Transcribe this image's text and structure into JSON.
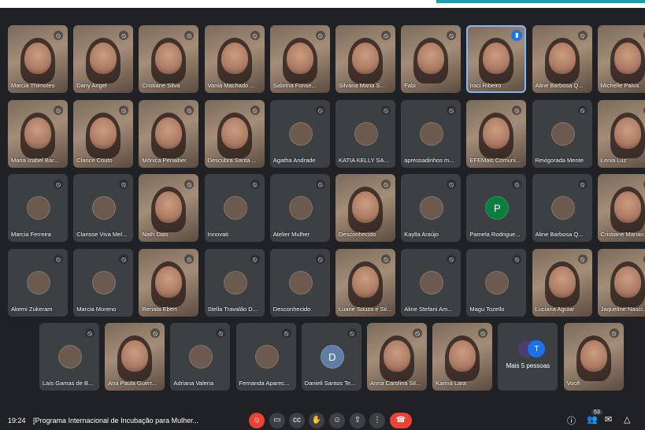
{
  "meeting": {
    "time": "19:24",
    "title": "[Programa Internacional de Incubação para Mulher...",
    "participants_count": "53"
  },
  "rows": [
    [
      {
        "name": "Marcia Thimoteo",
        "type": "video"
      },
      {
        "name": "Dany Angel",
        "type": "video"
      },
      {
        "name": "Cristiane Silva",
        "type": "video"
      },
      {
        "name": "Vania Machado ...",
        "type": "video"
      },
      {
        "name": "Sabrina Fonse...",
        "type": "video"
      },
      {
        "name": "Silvana Maria S...",
        "type": "video"
      },
      {
        "name": "Fabi",
        "type": "video"
      },
      {
        "name": "Iraci Ribeiro",
        "type": "video",
        "speaking": true
      },
      {
        "name": "Aline Barbosa Q...",
        "type": "video"
      },
      {
        "name": "Michelle Paiva",
        "type": "video"
      }
    ],
    [
      {
        "name": "Maria Izabel Bar...",
        "type": "video"
      },
      {
        "name": "Clarice Couto",
        "type": "video"
      },
      {
        "name": "Mônica Penaiber",
        "type": "video"
      },
      {
        "name": "Descubra Santa ...",
        "type": "video"
      },
      {
        "name": "Agatha Andrade",
        "type": "avatar"
      },
      {
        "name": "KATIA KELLY SA...",
        "type": "avatar"
      },
      {
        "name": "apressadinhos m...",
        "type": "avatar"
      },
      {
        "name": "EFEMais Comuni...",
        "type": "video"
      },
      {
        "name": "Revigorada Mente",
        "type": "avatar"
      },
      {
        "name": "Lenia Luz",
        "type": "video"
      }
    ],
    [
      {
        "name": "Marcia Ferreira",
        "type": "avatar"
      },
      {
        "name": "Clarisse Viva Mel...",
        "type": "avatar"
      },
      {
        "name": "Nath Dias",
        "type": "video"
      },
      {
        "name": "Innovati",
        "type": "avatar"
      },
      {
        "name": "Atelier Mulher",
        "type": "avatar"
      },
      {
        "name": "Desconhecido",
        "type": "video"
      },
      {
        "name": "Kaylla Araújo",
        "type": "avatar"
      },
      {
        "name": "Pamela Rodrigue...",
        "type": "avatar",
        "letter": "P"
      },
      {
        "name": "Aline Barbosa Q...",
        "type": "avatar"
      },
      {
        "name": "Cristiane Marian",
        "type": "video"
      }
    ],
    [
      {
        "name": "Akemi Zukeram",
        "type": "avatar"
      },
      {
        "name": "Marcia Moreno",
        "type": "avatar"
      },
      {
        "name": "Renata Ebert",
        "type": "video"
      },
      {
        "name": "Stella Travalão D...",
        "type": "avatar"
      },
      {
        "name": "Desconhecido",
        "type": "avatar"
      },
      {
        "name": "Luane Souza e Sil...",
        "type": "video"
      },
      {
        "name": "Aline Stefani Am...",
        "type": "avatar"
      },
      {
        "name": "Magu Tozello",
        "type": "avatar"
      },
      {
        "name": "Luciana Aguiar",
        "type": "video"
      },
      {
        "name": "Jaqueline Nasci...",
        "type": "video"
      }
    ],
    [
      {
        "name": "Laís Gamas de B...",
        "type": "avatar"
      },
      {
        "name": "Ana Paula Guerr...",
        "type": "video"
      },
      {
        "name": "Adriana Valeria",
        "type": "avatar"
      },
      {
        "name": "Fernanda Aparec...",
        "type": "avatar"
      },
      {
        "name": "Danieli Santos Te...",
        "type": "avatar",
        "letter": "D"
      },
      {
        "name": "Anna Carolina Sil...",
        "type": "video"
      },
      {
        "name": "Karina Lara",
        "type": "video"
      },
      {
        "name": "Mais 5 pessoas",
        "type": "more"
      },
      {
        "name": "Você",
        "type": "video"
      }
    ]
  ],
  "icons": {
    "mic_off": "mic-off-icon",
    "camera": "camera-icon",
    "captions": "captions-icon",
    "raise_hand": "raise-hand-icon",
    "emoji": "emoji-icon",
    "present": "present-icon",
    "more": "more-options-icon",
    "hang_up": "hang-up-icon",
    "info": "info-icon",
    "people": "people-icon",
    "chat": "chat-icon",
    "activities": "activities-icon"
  }
}
